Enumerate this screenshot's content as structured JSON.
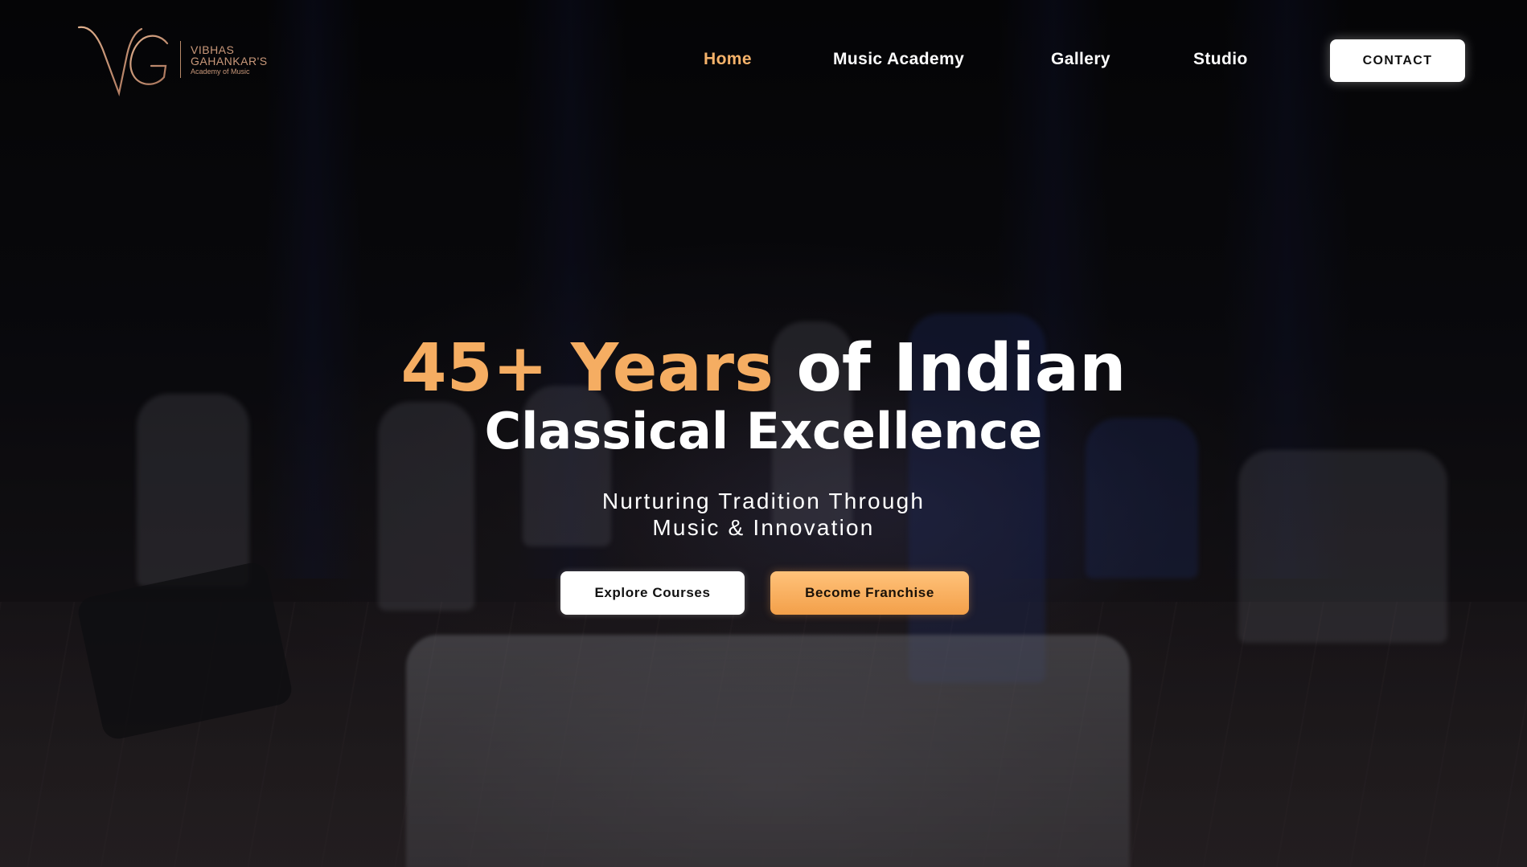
{
  "brand": {
    "line1": "VIBHAS",
    "line2": "GAHANKAR'S",
    "line3": "Academy of Music",
    "accent_color": "#c9987a"
  },
  "nav": {
    "items": [
      {
        "label": "Home",
        "active": true
      },
      {
        "label": "Music Academy",
        "active": false
      },
      {
        "label": "Gallery",
        "active": false
      },
      {
        "label": "Studio",
        "active": false
      }
    ],
    "contact_label": "CONTACT"
  },
  "hero": {
    "headline_accent": "45+ Years",
    "headline_rest": "of Indian",
    "headline_line2": "Classical Excellence",
    "subline1": "Nurturing Tradition Through",
    "subline2": "Music & Innovation",
    "primary_button": "Explore Courses",
    "secondary_button": "Become Franchise",
    "accent_color": "#f5ad62"
  }
}
